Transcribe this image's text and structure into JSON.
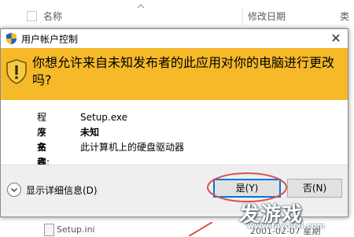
{
  "explorer": {
    "columns": {
      "name": "名称",
      "date_modified": "修改日期",
      "type": "类"
    },
    "bottom_row": {
      "name": "Setup.ini",
      "date": "2001-02-07 星期"
    }
  },
  "dialog": {
    "title": "用户帐户控制",
    "close_symbol": "✕",
    "question": "你想允许来自未知发布者的此应用对你的电脑进行更改吗?",
    "banner_color": "#f5b929",
    "info": [
      {
        "label": "程序名称:",
        "value": "Setup.exe",
        "bold": false
      },
      {
        "label": "发布者:",
        "value": "未知",
        "bold": true
      },
      {
        "label": "文件源:",
        "value": "此计算机上的硬盘驱动器",
        "bold": false
      }
    ],
    "show_details_label": "显示详细信息(D)",
    "yes_label": "是(Y)",
    "no_label": "否(N)",
    "default_button_color": "#0078d7",
    "annotation_color": "#d9534f"
  },
  "watermark": {
    "logo_text": "发游戏",
    "url": "www.fayouxi.com"
  }
}
